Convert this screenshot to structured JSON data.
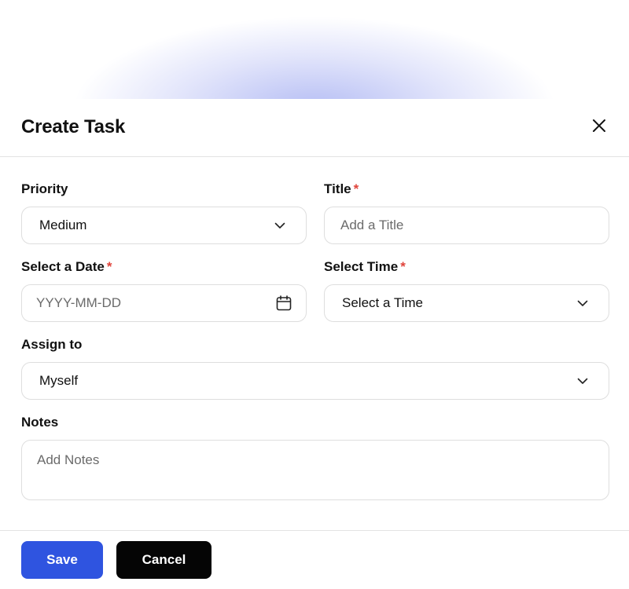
{
  "dialog": {
    "title": "Create Task",
    "close_icon": "close-icon"
  },
  "priority": {
    "label": "Priority",
    "value": "Medium",
    "icon": "chevron-down-icon"
  },
  "title_field": {
    "label": "Title",
    "required_mark": "*",
    "placeholder": "Add a Title",
    "value": ""
  },
  "date": {
    "label": "Select a Date",
    "required_mark": "*",
    "placeholder": "YYYY-MM-DD",
    "icon": "calendar-icon"
  },
  "time": {
    "label": "Select Time",
    "required_mark": "*",
    "value": "Select a Time",
    "icon": "chevron-down-icon"
  },
  "assign": {
    "label": "Assign to",
    "value": "Myself",
    "icon": "chevron-down-icon"
  },
  "notes": {
    "label": "Notes",
    "placeholder": "Add Notes"
  },
  "actions": {
    "save_label": "Save",
    "cancel_label": "Cancel"
  },
  "colors": {
    "primary": "#2f54e0",
    "cancel": "#050505",
    "required": "#e0443b",
    "border": "#dedede"
  }
}
